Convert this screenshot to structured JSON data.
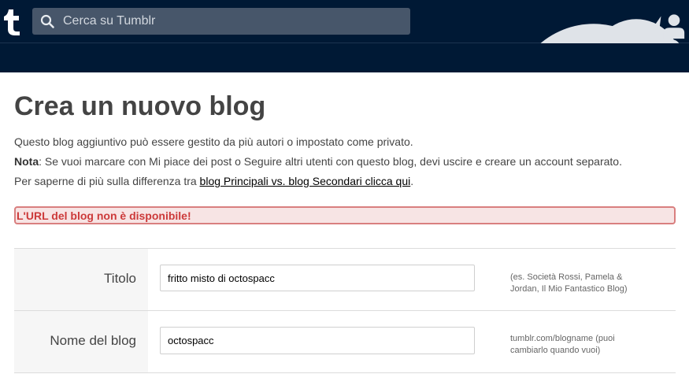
{
  "header": {
    "search_placeholder": "Cerca su Tumblr",
    "nav_icons": [
      "home-icon",
      "explore-icon",
      "inbox-icon",
      "activity-icon",
      "lightning-icon",
      "account-icon"
    ]
  },
  "page": {
    "title": "Crea un nuovo blog",
    "line1": "Questo blog aggiuntivo può essere gestito da più autori o impostato come privato.",
    "note_bold": "Nota",
    "note_text": ": Se vuoi marcare con Mi piace dei post o Seguire altri utenti con questo blog, devi uscire e creare un account separato.",
    "line3_text": "Per saperne di più sulla differenza tra ",
    "line3_link": "blog Principali vs. blog Secondari clicca qui",
    "line3_end": ".",
    "error": "L'URL del blog non è disponibile!"
  },
  "form": {
    "title_label": "Titolo",
    "title_value": "fritto misto di octospacc",
    "title_hint": "(es. Società Rossi, Pamela & Jordan, Il Mio Fantastico Blog)",
    "name_label": "Nome del blog",
    "name_value": "octospacc",
    "name_hint": "tumblr.com/blogname (puoi cambiarlo quando vuoi)"
  },
  "colors": {
    "navy": "#001935",
    "error_text": "#cc3a3a",
    "error_bg": "#f7e4e4"
  }
}
